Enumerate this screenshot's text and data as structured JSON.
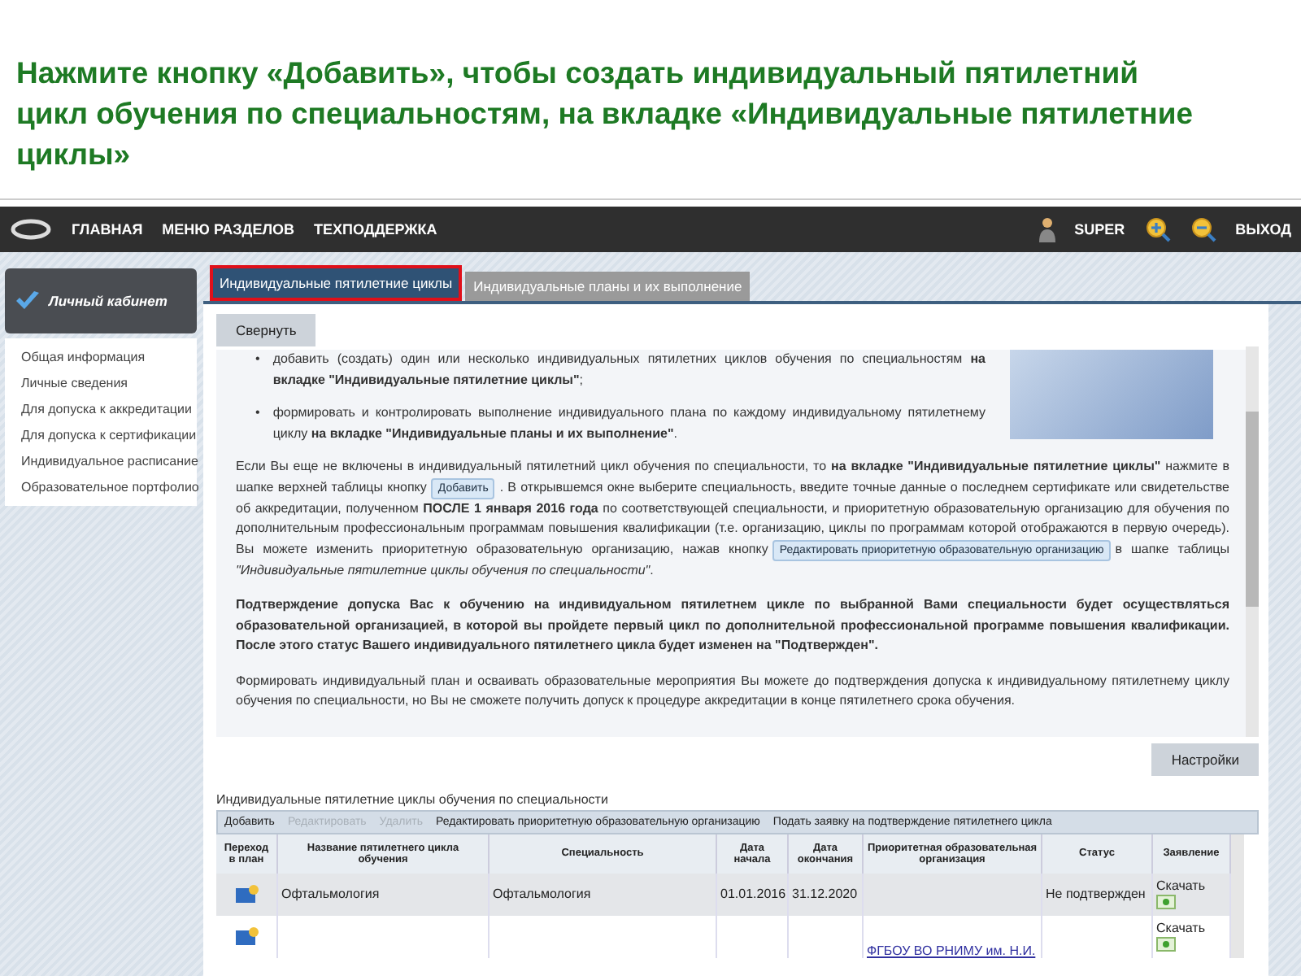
{
  "heading": "Нажмите кнопку «Добавить», чтобы создать индивидуальный пятилетний цикл обучения по специальностям, на вкладке «Индивидуальные пятилетние циклы»",
  "nav": {
    "items": [
      "ГЛАВНАЯ",
      "МЕНЮ РАЗДЕЛОВ",
      "ТЕХПОДДЕРЖКА"
    ],
    "user": "SUPER",
    "logout": "ВЫХОД"
  },
  "sidebar": {
    "title": "Личный кабинет",
    "items": [
      "Общая информация",
      "Личные сведения",
      "Для допуска к аккредитации",
      "Для допуска к сертификации",
      "Индивидуальное расписание",
      "Образовательное портфолио"
    ]
  },
  "tabs": [
    {
      "label": "Индивидуальные пятилетние циклы",
      "selected": true,
      "highlighted": true
    },
    {
      "label": "Индивидуальные планы и их выполнение",
      "selected": false,
      "highlighted": false
    }
  ],
  "collapse_button": "Свернуть",
  "bullets": [
    {
      "marker": "•",
      "text": "добавить (создать) один или несколько индивидуальных пятилетних циклов обучения по специальностям **на вкладке \"Индивидуальные пятилетние циклы\"**;"
    },
    {
      "marker": "•",
      "text": "формировать и контролировать выполнение индивидуального плана по каждому индивидуальному пятилетнему циклу **на вкладке \"Индивидуальные планы и их выполнение\"**."
    }
  ],
  "paragraphs": [
    {
      "bold": false,
      "segments": [
        {
          "kind": "text",
          "text": "Если Вы еще не включены в индивидуальный пятилетний цикл обучения по специальности, то **на вкладке \"Индивидуальные пятилетние циклы\"** нажмите в шапке верхней таблицы кнопку"
        },
        {
          "kind": "button",
          "text": "Добавить"
        },
        {
          "kind": "text",
          "text": ". В открывшемся окне выберите специальность, введите точные данные о последнем сертификате или свидетельстве об аккредитации, полученном **ПОСЛЕ 1 января 2016 года** по соответствующей специальности, и приоритетную образовательную организацию для обучения по дополнительным профессиональным программам повышения квалификации (т.е. организацию, циклы по программам которой отображаются в первую очередь). Вы можете изменить приоритетную образовательную организацию, нажав кнопку"
        },
        {
          "kind": "button",
          "text": "Редактировать приоритетную образовательную организацию"
        },
        {
          "kind": "text",
          "text": "в шапке таблицы *\"Индивидуальные пятилетние циклы обучения по специальности\"*."
        }
      ]
    },
    {
      "bold": true,
      "segments": [
        {
          "kind": "text",
          "text": "Подтверждение допуска Вас к обучению на индивидуальном пятилетнем цикле по выбранной Вами специальности будет осуществляться образовательной организацией, в которой вы пройдете первый цикл по дополнительной профессиональной программе повышения квалификации. После этого статус Вашего индивидуального пятилетнего цикла будет изменен на \"Подтвержден\"."
        }
      ]
    },
    {
      "bold": false,
      "segments": [
        {
          "kind": "text",
          "text": "Формировать индивидуальный план и осваивать образовательные мероприятия Вы можете до подтверждения допуска к индивидуальному пятилетнему циклу обучения по специальности, но Вы не сможете получить допуск к процедуре аккредитации в конце пятилетнего срока обучения."
        }
      ]
    }
  ],
  "settings_button": "Настройки",
  "table": {
    "title": "Индивидуальные пятилетние циклы обучения по специальности",
    "toolbar": [
      {
        "label": "Добавить",
        "disabled": false
      },
      {
        "label": "Редактировать",
        "disabled": true
      },
      {
        "label": "Удалить",
        "disabled": true
      },
      {
        "label": "Редактировать приоритетную образовательную организацию",
        "disabled": false
      },
      {
        "label": "Подать заявку на подтверждение пятилетнего цикла",
        "disabled": false
      }
    ],
    "columns": [
      "Переход в план",
      "Название пятилетнего цикла обучения",
      "Специальность",
      "Дата начала",
      "Дата окончания",
      "Приоритетная образовательная организация",
      "Статус",
      "Заявление"
    ],
    "rows": [
      {
        "selected": true,
        "name": "Офтальмология",
        "specialty": "Офтальмология",
        "start": "01.01.2016",
        "end": "31.12.2020",
        "status": "Не подтвержден",
        "download": "Скачать"
      },
      {
        "selected": false,
        "organization": "ФГБОУ ВО РНИМУ им. Н.И.",
        "download": "Скачать"
      }
    ]
  }
}
